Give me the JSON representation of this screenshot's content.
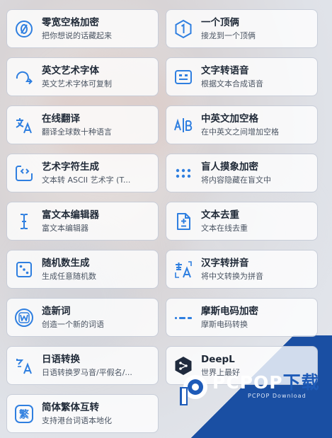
{
  "tools": [
    {
      "title": "零宽空格加密",
      "desc": "把你想说的话藏起来",
      "icon": "zero-slash-circle-icon"
    },
    {
      "title": "一个顶俩",
      "desc": "接龙到一个顶俩",
      "icon": "number-one-hexagon-icon"
    },
    {
      "title": "英文艺术字体",
      "desc": "英文艺术字体可复制",
      "icon": "curved-arrow-icon"
    },
    {
      "title": "文字转语音",
      "desc": "根据文本合成语音",
      "icon": "speech-box-icon"
    },
    {
      "title": "在线翻译",
      "desc": "翻译全球数十种语言",
      "icon": "translate-icon"
    },
    {
      "title": "中英文加空格",
      "desc": "在中英文之间增加空格",
      "icon": "ab-divider-icon"
    },
    {
      "title": "艺术字符生成",
      "desc": "文本转 ASCII 艺术字 (T...",
      "icon": "code-frame-icon"
    },
    {
      "title": "盲人摸象加密",
      "desc": "将内容隐藏在盲文中",
      "icon": "braille-dots-icon"
    },
    {
      "title": "富文本编辑器",
      "desc": "富文本编辑器",
      "icon": "text-cursor-icon"
    },
    {
      "title": "文本去重",
      "desc": "文本在线去重",
      "icon": "file-diff-icon"
    },
    {
      "title": "随机数生成",
      "desc": "生成任意随机数",
      "icon": "dice-icon"
    },
    {
      "title": "汉字转拼音",
      "desc": "将中文转换为拼音",
      "icon": "chinese-to-latin-icon"
    },
    {
      "title": "造新词",
      "desc": "创造一个新的词语",
      "icon": "letter-w-circle-icon"
    },
    {
      "title": "摩斯电码加密",
      "desc": "摩斯电码转换",
      "icon": "morse-code-icon"
    },
    {
      "title": "日语转换",
      "desc": "日语转换罗马音/平假名/...",
      "icon": "japanese-latin-icon"
    },
    {
      "title": "DeepL",
      "desc": "世界上最好",
      "icon": "deepl-logo-icon"
    },
    {
      "title": "简体繁体互转",
      "desc": "支持港台词语本地化",
      "icon": "traditional-char-icon"
    }
  ],
  "icon_glyphs": {
    "traditional": "繁"
  },
  "watermark": {
    "brand_white": "PCPOP",
    "brand_blue": "下载",
    "sub": "PCPOP Download"
  },
  "colors": {
    "icon_blue": "#2f7fe0",
    "watermark_blue": "#1e5bb8"
  }
}
